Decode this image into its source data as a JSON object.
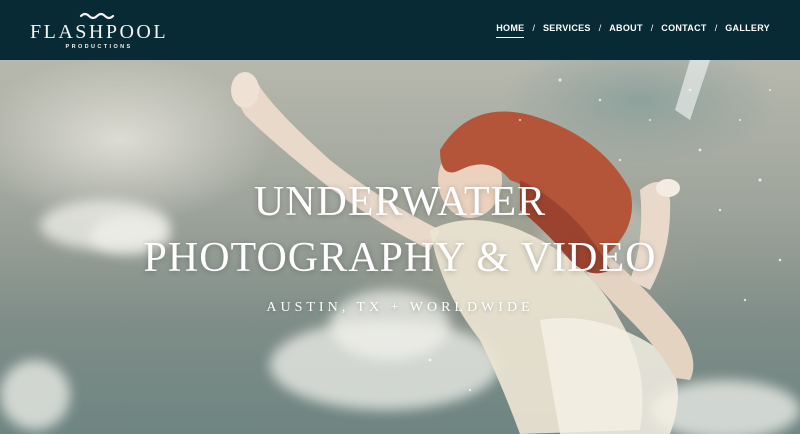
{
  "brand": {
    "name": "FLASHPOOL",
    "tagline": "PRODUCTIONS",
    "logo_icon": "wave-icon"
  },
  "nav": {
    "items": [
      {
        "label": "HOME",
        "active": true
      },
      {
        "label": "SERVICES",
        "active": false
      },
      {
        "label": "ABOUT",
        "active": false
      },
      {
        "label": "CONTACT",
        "active": false
      },
      {
        "label": "GALLERY",
        "active": false
      }
    ],
    "separator": "/"
  },
  "hero": {
    "title_line1": "UNDERWATER",
    "title_line2": "PHOTOGRAPHY & VIDEO",
    "subtitle": "AUSTIN, TX + WORLDWIDE"
  },
  "colors": {
    "header_bg": "#082a35",
    "text": "#ffffff"
  }
}
